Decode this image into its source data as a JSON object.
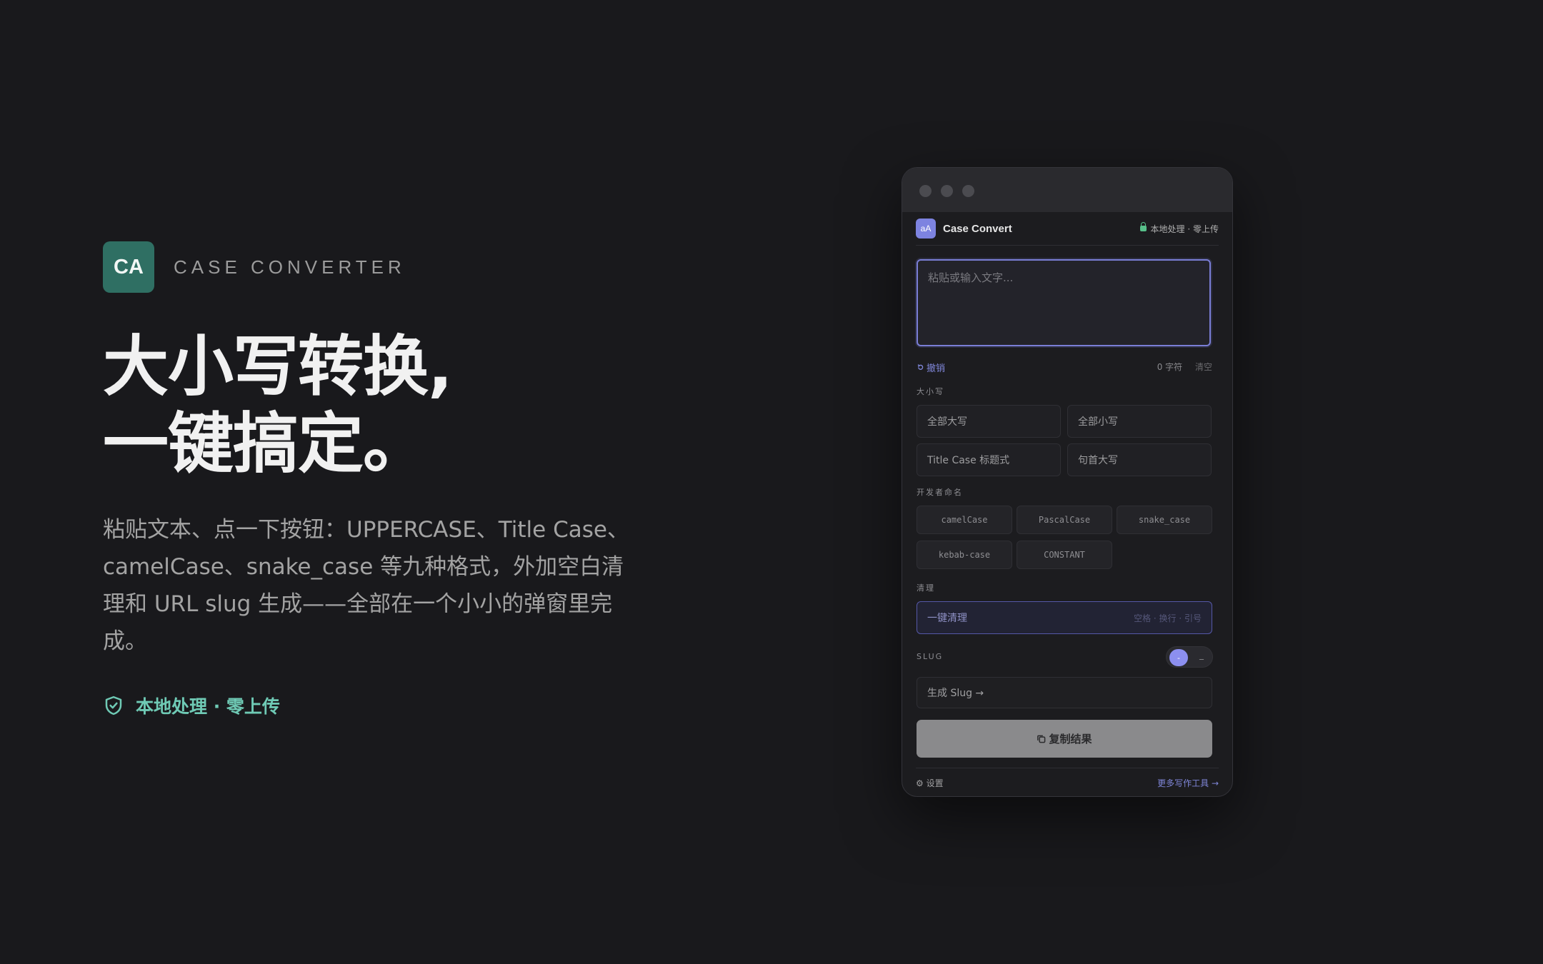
{
  "hero": {
    "logo_text": "CA",
    "brand_name": "CASE CONVERTER",
    "headline_line1": "大小写转换,",
    "headline_line2": "一键搞定。",
    "description": "粘贴文本、点一下按钮：UPPERCASE、Title Case、camelCase、snake_case 等九种格式，外加空白清理和 URL slug 生成——全部在一个小小的弹窗里完成。",
    "privacy_text": "本地处理 · 零上传",
    "privacy_icon": "shield-check-icon",
    "accent_color": "#6fcab5"
  },
  "popup": {
    "logo_text": "aA",
    "title": "Case Convert",
    "privacy_badge": "本地处理 · 零上传",
    "input_placeholder": "粘贴或输入文字...",
    "undo_label": "撤销",
    "char_count": "0 字符",
    "clear_label": "清空",
    "case_section_label": "大小写",
    "case_buttons": [
      "全部大写",
      "全部小写",
      "Title Case 标题式",
      "句首大写"
    ],
    "dev_section_label": "开发者命名",
    "dev_buttons": [
      "camelCase",
      "PascalCase",
      "snake_case",
      "kebab-case",
      "CONSTANT"
    ],
    "clean_section_label": "清理",
    "clean_button_label": "一键清理",
    "clean_button_hint": "空格 · 换行 · 引号",
    "slug_section_label": "SLUG",
    "slug_toggle_selected": "-",
    "slug_toggle_other": "_",
    "slug_button_label": "生成 Slug →",
    "copy_button_label": "复制结果",
    "settings_label": "设置",
    "more_tools_label": "更多写作工具 →",
    "accent_color": "#7f86d8"
  }
}
